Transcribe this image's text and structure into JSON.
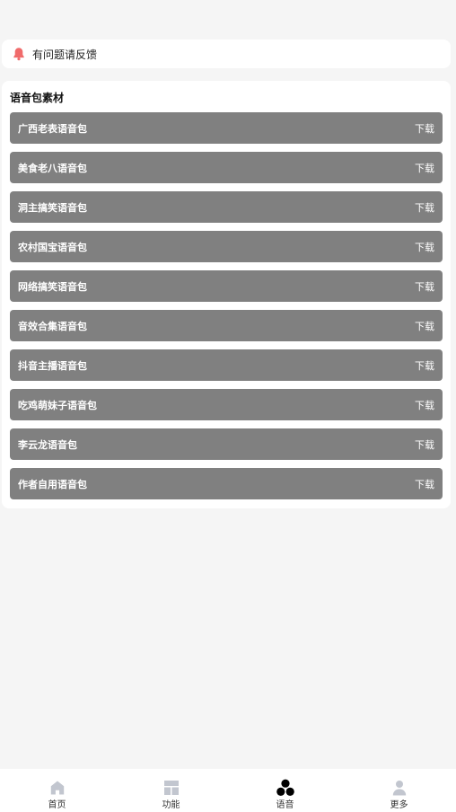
{
  "notice": {
    "text": "有问题请反馈",
    "icon": "bell-icon",
    "icon_color": "#f06b6b"
  },
  "section": {
    "title": "语音包素材",
    "items": [
      {
        "name": "广西老表语音包",
        "action": "下载"
      },
      {
        "name": "美食老八语音包",
        "action": "下载"
      },
      {
        "name": "洞主搞笑语音包",
        "action": "下载"
      },
      {
        "name": "农村国宝语音包",
        "action": "下载"
      },
      {
        "name": "网络搞笑语音包",
        "action": "下载"
      },
      {
        "name": "音效合集语音包",
        "action": "下载"
      },
      {
        "name": "抖音主播语音包",
        "action": "下载"
      },
      {
        "name": "吃鸡萌妹子语音包",
        "action": "下载"
      },
      {
        "name": "李云龙语音包",
        "action": "下载"
      },
      {
        "name": "作者自用语音包",
        "action": "下载"
      }
    ]
  },
  "tabbar": {
    "active": "语音",
    "tabs": [
      {
        "label": "首页",
        "icon": "home-icon"
      },
      {
        "label": "功能",
        "icon": "function-icon"
      },
      {
        "label": "语音",
        "icon": "voice-icon"
      },
      {
        "label": "更多",
        "icon": "user-icon"
      }
    ]
  },
  "colors": {
    "row_bg": "#808080",
    "inactive_icon": "#c2c6cf",
    "active_icon": "#000000"
  }
}
